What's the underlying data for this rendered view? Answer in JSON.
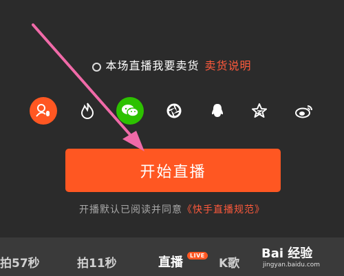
{
  "sell_option": {
    "label": "本场直播我要卖货",
    "link": "卖货说明"
  },
  "share_icons": [
    {
      "name": "user-mic-icon",
      "bg": "#ff5722"
    },
    {
      "name": "flame-icon",
      "bg": "transparent"
    },
    {
      "name": "wechat-icon",
      "bg": "#2dc100"
    },
    {
      "name": "moments-icon",
      "bg": "transparent"
    },
    {
      "name": "qq-icon",
      "bg": "transparent"
    },
    {
      "name": "qzone-icon",
      "bg": "transparent"
    },
    {
      "name": "weibo-icon",
      "bg": "transparent"
    }
  ],
  "start_button": {
    "label": "开始直播"
  },
  "agreement": {
    "prefix": "开播默认已阅读并同意",
    "link": "《快手直播规范》"
  },
  "tabs": [
    {
      "label": "拍57秒",
      "active": false
    },
    {
      "label": "拍11秒",
      "active": false
    },
    {
      "label": "直播",
      "active": true
    },
    {
      "label": "K歌",
      "active": false
    }
  ],
  "live_badge": "LIVE",
  "watermark": {
    "brand": "Bai 经验",
    "url": "jingyan.baidu.com"
  },
  "colors": {
    "accent": "#ff5722",
    "link": "#ff5a3c",
    "background": "#2b2b2b",
    "wechat": "#2dc100",
    "annotation_arrow": "#f06aa8"
  }
}
